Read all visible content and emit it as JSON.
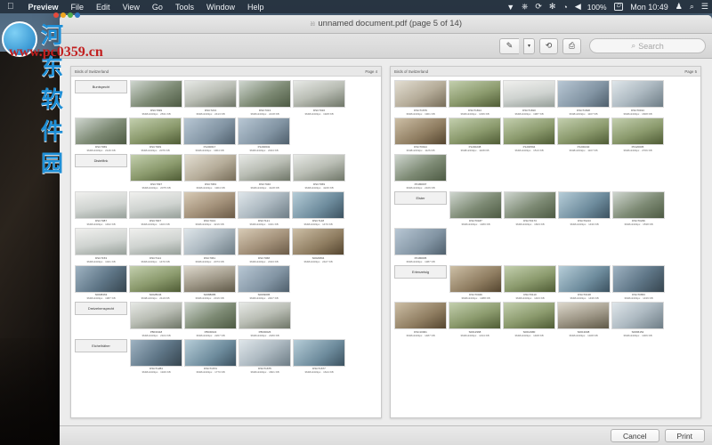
{
  "menubar": {
    "apple_icon": "apple-icon",
    "items": [
      {
        "label": "Preview",
        "bold": true
      },
      {
        "label": "File"
      },
      {
        "label": "Edit"
      },
      {
        "label": "View"
      },
      {
        "label": "Go"
      },
      {
        "label": "Tools"
      },
      {
        "label": "Window"
      },
      {
        "label": "Help"
      }
    ],
    "status": {
      "dropbox": "▼",
      "airplay": "⎙",
      "timemachine": "⟳",
      "bluetooth": "✳",
      "wifi": "◡",
      "volume": "◀",
      "battery_percent": "100%",
      "battery_icon": "⚡",
      "clock": "Mon 10:49",
      "user": "👤",
      "search": "⌕",
      "notifications": "☰"
    }
  },
  "window": {
    "title": "unnamed document.pdf (page 5 of 14)",
    "page_icon": "page-icon"
  },
  "toolbar": {
    "markup": "✎",
    "markup_menu": "▾",
    "rotate": "⟲",
    "share": "⎙",
    "search_placeholder": "Search",
    "search_value": "",
    "search_icon": "⌕"
  },
  "bottom": {
    "cancel_label": "Cancel",
    "print_label": "Print"
  },
  "watermark": {
    "cn_text": "河东软件园",
    "url_text": "www.pc0359.cn"
  },
  "pages": [
    {
      "header_title": "Birds of Switzerland",
      "page_label": "Page 4",
      "groups": [
        {
          "label": "Buntspecht",
          "thumbs": [
            {
              "file": "DSC7099",
              "meta": "3648x2432px · 2631 KB",
              "palette": "p1"
            },
            {
              "file": "DSC7213",
              "meta": "3648x2432px · 2413 KB",
              "palette": "p2"
            },
            {
              "file": "DSC7313",
              "meta": "3648x2432px · 2218 KB",
              "palette": "p1"
            },
            {
              "file": "DSC7016",
              "meta": "3648x2432px · 1928 KB",
              "palette": "p2"
            },
            {
              "file": "DSC7069",
              "meta": "3648x2432px · 2146 KB",
              "palette": "p1"
            },
            {
              "file": "DSC7009",
              "meta": "3648x2432px · 2076 KB",
              "palette": "p9"
            },
            {
              "file": "P1200617",
              "meta": "3648x2432px · 1964 KB",
              "palette": "p3"
            },
            {
              "file": "P1200632",
              "meta": "3648x2432px · 2044 KB",
              "palette": "p3"
            }
          ]
        },
        {
          "label": "Distelfink",
          "thumbs": [
            {
              "file": "DSC7097",
              "meta": "3648x2432px · 2075 KB",
              "palette": "p9"
            },
            {
              "file": "DSC7063",
              "meta": "3648x2432px · 1904 KB",
              "palette": "p10"
            },
            {
              "file": "DSC7040",
              "meta": "3648x2432px · 4128 KB",
              "palette": "p2"
            },
            {
              "file": "DSC7069",
              "meta": "3648x2432px · 4246 KB",
              "palette": "p2"
            },
            {
              "file": "DSC7087",
              "meta": "3648x2432px · 1462 KB",
              "palette": "p5"
            },
            {
              "file": "DSC7007",
              "meta": "3648x2432px · 1403 KB",
              "palette": "p5"
            },
            {
              "file": "DSC7013",
              "meta": "3648x2432px · 4216 KB",
              "palette": "p4"
            },
            {
              "file": "DSC7121",
              "meta": "3648x2432px · 1041 KB",
              "palette": "p8"
            },
            {
              "file": "DSC7148",
              "meta": "3648x2432px · 1470 KB",
              "palette": "p11"
            },
            {
              "file": "DSC7153",
              "meta": "3648x2432px · 1021 KB",
              "palette": "p5"
            },
            {
              "file": "DSC7114",
              "meta": "3648x2432px · 1470 KB",
              "palette": "p5"
            },
            {
              "file": "DSC7061",
              "meta": "3648x2432px · 2073 KB",
              "palette": "p8"
            },
            {
              "file": "DSC7068",
              "meta": "3648x2432px · 2043 KB",
              "palette": "p4"
            },
            {
              "file": "S0020804",
              "meta": "3648x2432px · 2427 KB",
              "palette": "p7"
            },
            {
              "file": "S0008463",
              "meta": "3648x2432px · 1987 KB",
              "palette": "p6"
            },
            {
              "file": "S0028046",
              "meta": "3648x2432px · 2119 KB",
              "palette": "p9"
            },
            {
              "file": "S0088085",
              "meta": "3648x2432px · 2316 KB",
              "palette": "p12"
            },
            {
              "file": "S0009095",
              "meta": "3648x2432px · 2407 KB",
              "palette": "p3"
            }
          ]
        },
        {
          "label": "Dreizehenspecht",
          "thumbs": [
            {
              "file": "P8030118",
              "meta": "3648x2432px · 2104 KB",
              "palette": "p2"
            },
            {
              "file": "P8030022",
              "meta": "3648x2432px · 2267 KB",
              "palette": "p1"
            },
            {
              "file": "P8030026",
              "meta": "3648x2432px · 2180 KB",
              "palette": "p2"
            }
          ]
        },
        {
          "label": "Eichelhäher",
          "thumbs": [
            {
              "file": "DSC71284",
              "meta": "3648x2432px · 1946 KB",
              "palette": "p6"
            },
            {
              "file": "DSC71674",
              "meta": "3648x2432px · 1770 KB",
              "palette": "p11"
            },
            {
              "file": "DSC71675",
              "meta": "3648x2432px · 1821 KB",
              "palette": "p8"
            },
            {
              "file": "DSC71677",
              "meta": "3648x2432px · 1644 KB",
              "palette": "p11"
            }
          ]
        }
      ]
    },
    {
      "header_title": "Birds of Switzerland",
      "page_label": "Page 5",
      "groups": [
        {
          "label": "",
          "thumbs": [
            {
              "file": "DSC71679",
              "meta": "3648x2432px · 1901 KB",
              "palette": "p10"
            },
            {
              "file": "DSC71814",
              "meta": "3648x2432px · 1036 KB",
              "palette": "p9"
            },
            {
              "file": "DSC71810",
              "meta": "3648x2432px · 1987 KB",
              "palette": "p5"
            },
            {
              "file": "DSC71818",
              "meta": "3648x2432px · 1107 KB",
              "palette": "p3"
            },
            {
              "file": "DSC70194",
              "meta": "3648x2432px · 1668 KB",
              "palette": "p8"
            },
            {
              "file": "DSC70914",
              "meta": "3648x2432px · 1126 KB",
              "palette": "p7"
            },
            {
              "file": "P1200238",
              "meta": "3648x2432px · 1108 KB",
              "palette": "p9"
            },
            {
              "file": "P1200594",
              "meta": "3648x2432px · 1513 KB",
              "palette": "p9"
            },
            {
              "file": "P1200240",
              "meta": "3648x2432px · 1107 KB",
              "palette": "p9"
            },
            {
              "file": "P0120005",
              "meta": "3648x2432px · 2706 KB",
              "palette": "p9"
            },
            {
              "file": "P0180007",
              "meta": "3648x2432px · 2106 KB",
              "palette": "p1"
            }
          ]
        },
        {
          "label": "Elster",
          "thumbs": [
            {
              "file": "DSC70187",
              "meta": "3648x2432px · 1480 KB",
              "palette": "p1"
            },
            {
              "file": "DSC70173",
              "meta": "3648x2432px · 1603 KB",
              "palette": "p1"
            },
            {
              "file": "DSC70213",
              "meta": "3648x2432px · 1430 KB",
              "palette": "p11"
            },
            {
              "file": "DSC70236",
              "meta": "3648x2432px · 1538 KB",
              "palette": "p1"
            },
            {
              "file": "P0180005",
              "meta": "3648x2432px · 1387 KB",
              "palette": "p3"
            }
          ]
        },
        {
          "label": "Erlenzeisig",
          "thumbs": [
            {
              "file": "DSC70046",
              "meta": "3648x2432px · 1388 KB",
              "palette": "p7"
            },
            {
              "file": "DSC70110",
              "meta": "3648x2432px · 1403 KB",
              "palette": "p9"
            },
            {
              "file": "DSC70138",
              "meta": "3648x2432px · 1436 KB",
              "palette": "p11"
            },
            {
              "file": "DSC70653",
              "meta": "3648x2432px · 1439 KB",
              "palette": "p6"
            },
            {
              "file": "DSC10001",
              "meta": "3648x2432px · 1487 KB",
              "palette": "p7"
            },
            {
              "file": "S0012968",
              "meta": "3648x2432px · 1434 KB",
              "palette": "p9"
            },
            {
              "file": "S0012980",
              "meta": "3648x2432px · 1408 KB",
              "palette": "p9"
            },
            {
              "file": "S0013008",
              "meta": "3648x2432px · 1328 KB",
              "palette": "p12"
            },
            {
              "file": "S0096152",
              "meta": "3648x2432px · 1306 KB",
              "palette": "p8"
            }
          ]
        }
      ]
    }
  ]
}
